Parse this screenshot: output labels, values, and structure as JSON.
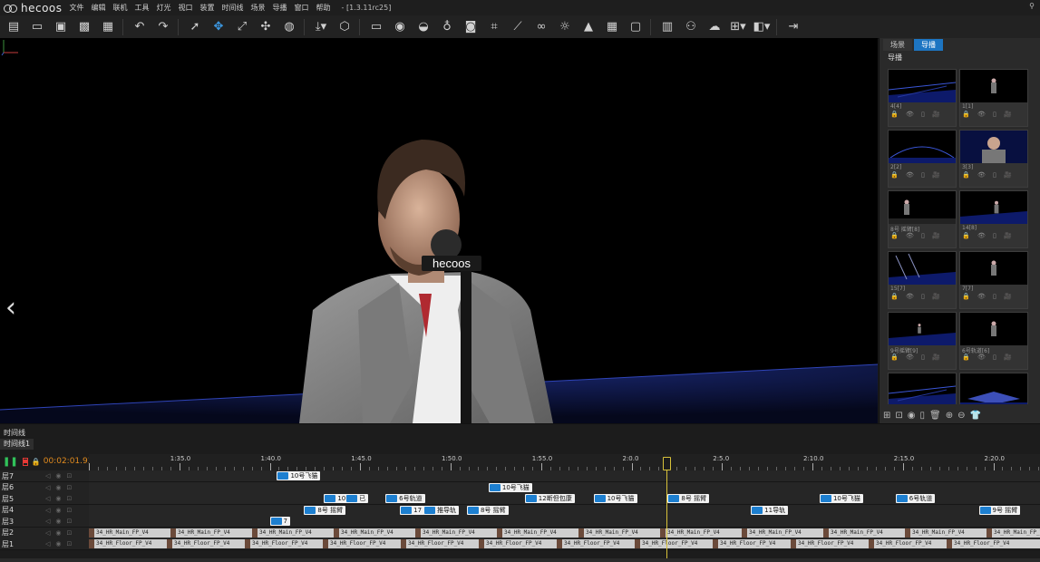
{
  "app": {
    "logo_text": "hecoos",
    "menu": [
      "文件",
      "编辑",
      "联机",
      "工具",
      "灯光",
      "视口",
      "装置",
      "时间线",
      "场景",
      "导播",
      "窗口",
      "帮助"
    ],
    "version": "- [1.3.11rc25]"
  },
  "toolbar": {
    "groups": [
      [
        "new-file-icon",
        "open-folder-icon",
        "save-icon",
        "save-as-icon",
        "briefcase-icon"
      ],
      [
        "undo-icon",
        "redo-icon"
      ],
      [
        "select-cursor-icon",
        "move-arrows-icon",
        "scale-icon",
        "rotate-icon",
        "globe-icon"
      ],
      [
        "download-dropdown-icon",
        "cube-icon"
      ],
      [
        "text-box-icon",
        "eye-icon",
        "tracker-icon",
        "bulb-icon",
        "camera-icon",
        "focus-frame-icon",
        "ruler-icon",
        "link-icon",
        "sun-icon",
        "rocket-icon",
        "grid-plane-icon",
        "fps-monitor-icon"
      ],
      [
        "display-panel-icon",
        "crowd-icon",
        "weather-icon",
        "layout-grid-icon",
        "split-view-icon"
      ],
      [
        "exit-icon"
      ]
    ],
    "accent_icon": "move-arrows-icon"
  },
  "viewport": {
    "mic_brand": "hecoos",
    "background_color": "#000000",
    "floor_color": "#0a1030"
  },
  "right_panel": {
    "tabs": [
      {
        "label": "场景",
        "active": false
      },
      {
        "label": "导播",
        "active": true
      }
    ],
    "title": "导播",
    "shots": [
      {
        "label": "4[4]",
        "thumb": "stage-wide"
      },
      {
        "label": "1[1]",
        "thumb": "person"
      },
      {
        "label": "2[2]",
        "thumb": "stage-arc"
      },
      {
        "label": "3[3]",
        "thumb": "person-close"
      },
      {
        "label": "8号 摇臂[8]",
        "thumb": "person-side"
      },
      {
        "label": "14[8]",
        "thumb": "person-dark"
      },
      {
        "label": "15[7]",
        "thumb": "stage-lights"
      },
      {
        "label": "7[7]",
        "thumb": "person"
      },
      {
        "label": "9号摇臂[9]",
        "thumb": "person-small"
      },
      {
        "label": "6号轨道[6]",
        "thumb": "person"
      },
      {
        "label": "",
        "thumb": "stage-wide"
      },
      {
        "label": "",
        "thumb": "stage-platform"
      }
    ],
    "shot_icons": "🔒 👁 ▯ 🎥",
    "bottom_icons": [
      "grid-icon",
      "lock-icon",
      "eye-icon",
      "copy-icon",
      "trash-icon",
      "zoom-in-icon",
      "zoom-out-icon",
      "shirt-icon"
    ]
  },
  "timeline": {
    "panel_title": "时间线",
    "tab_label": "时间线1",
    "current_time": "00:02:01.933",
    "ruler_ticks": [
      {
        "label": "1:35.0",
        "t": 95
      },
      {
        "label": "1:40.0",
        "t": 100
      },
      {
        "label": "1:45.0",
        "t": 105
      },
      {
        "label": "1:50.0",
        "t": 110
      },
      {
        "label": "1:55.0",
        "t": 115
      },
      {
        "label": "2:0.0",
        "t": 120
      },
      {
        "label": "2:5.0",
        "t": 125
      },
      {
        "label": "2:10.0",
        "t": 130
      },
      {
        "label": "2:15.0",
        "t": 135
      },
      {
        "label": "2:20.0",
        "t": 140
      }
    ],
    "playhead_t": 121.93,
    "tracks": [
      {
        "name": "层7",
        "clips": [
          {
            "label": "10号飞猫",
            "t": 100.4
          }
        ]
      },
      {
        "name": "层6",
        "clips": [
          {
            "label": "10号飞猫",
            "t": 112.1
          }
        ]
      },
      {
        "name": "层5",
        "clips": [
          {
            "label": "10号",
            "t": 103.0
          },
          {
            "label": "已",
            "t": 104.2
          },
          {
            "label": "6号轨道",
            "t": 106.4
          },
          {
            "label": "12断但包康",
            "t": 114.1
          },
          {
            "label": "10号飞猫",
            "t": 117.9
          },
          {
            "label": "8号 摇臂",
            "t": 122.0
          },
          {
            "label": "10号飞猫",
            "t": 130.4
          },
          {
            "label": "6号轨道",
            "t": 134.6
          },
          {
            "label": "",
            "t": 143.3
          }
        ]
      },
      {
        "name": "层4",
        "clips": [
          {
            "label": "8号 摇臂",
            "t": 101.9
          },
          {
            "label": "17",
            "t": 107.2
          },
          {
            "label": "推导轨",
            "t": 108.5
          },
          {
            "label": "8号 摇臂",
            "t": 110.9
          },
          {
            "label": "11导轨",
            "t": 126.6
          },
          {
            "label": "9号 摇臂",
            "t": 139.2
          }
        ]
      },
      {
        "name": "层3",
        "clips": [
          {
            "label": "7",
            "t": 100.0
          }
        ]
      },
      {
        "name": "层2",
        "strip": "34_HR_Main_FP_V4"
      },
      {
        "name": "层1",
        "strip": "34_HR_Floor_FP_V4"
      }
    ]
  }
}
